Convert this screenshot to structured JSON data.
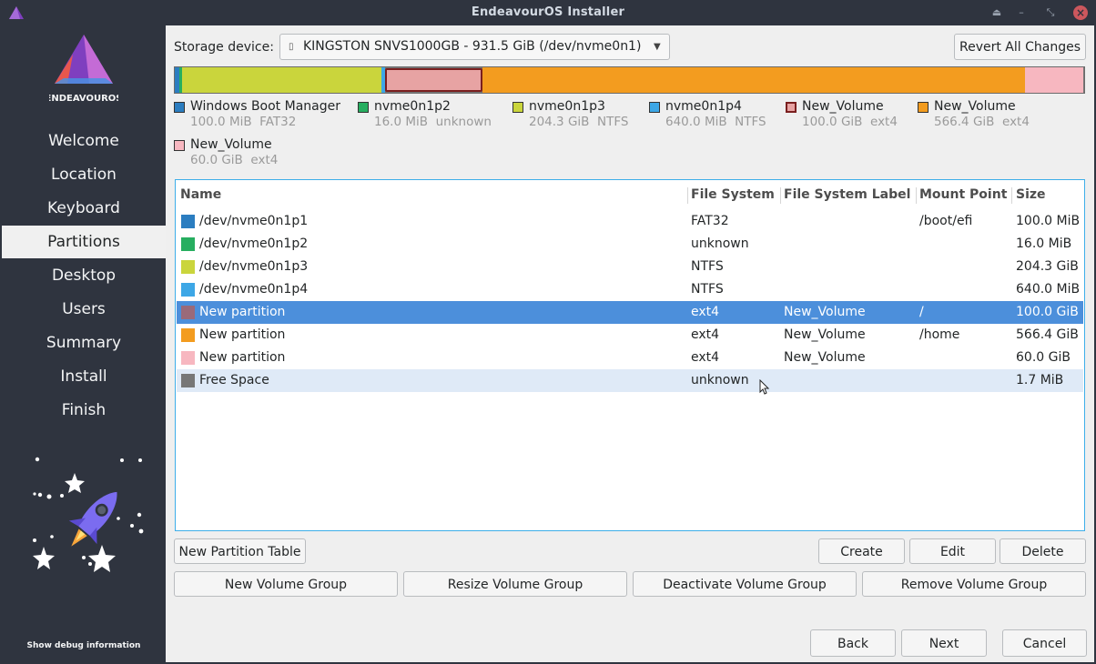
{
  "window": {
    "title": "EndeavourOS Installer"
  },
  "sidebar": {
    "logo_text": "ENDEAVOUROS",
    "items": [
      {
        "label": "Welcome",
        "active": false
      },
      {
        "label": "Location",
        "active": false
      },
      {
        "label": "Keyboard",
        "active": false
      },
      {
        "label": "Partitions",
        "active": true
      },
      {
        "label": "Desktop",
        "active": false
      },
      {
        "label": "Users",
        "active": false
      },
      {
        "label": "Summary",
        "active": false
      },
      {
        "label": "Install",
        "active": false
      },
      {
        "label": "Finish",
        "active": false
      }
    ],
    "debug_label": "Show debug information"
  },
  "storage": {
    "label": "Storage device:",
    "device": "KINGSTON SNVS1000GB - 931.5 GiB (/dev/nvme0n1)",
    "revert_label": "Revert All Changes"
  },
  "partition_bar": [
    {
      "color": "#2b7dc0",
      "fraction": 0.0001
    },
    {
      "color": "#27ae60",
      "fraction": 2e-05
    },
    {
      "color": "#cad53c",
      "fraction": 0.2193
    },
    {
      "color": "#3da7e6",
      "fraction": 0.0007
    },
    {
      "color": "#e7a3a3",
      "fraction": 0.1074,
      "outlined": true
    },
    {
      "color": "#f39c1f",
      "fraction": 0.6077
    },
    {
      "color": "#f7b7c0",
      "fraction": 0.0644
    },
    {
      "color": "#777777",
      "fraction": 0.0004
    }
  ],
  "legend": [
    {
      "name": "Windows Boot Manager",
      "info": "100.0 MiB  FAT32",
      "color": "#2b7dc0"
    },
    {
      "name": "nvme0n1p2",
      "info": "16.0 MiB  unknown",
      "color": "#27ae60"
    },
    {
      "name": "nvme0n1p3",
      "info": "204.3 GiB  NTFS",
      "color": "#cad53c"
    },
    {
      "name": "nvme0n1p4",
      "info": "640.0 MiB  NTFS",
      "color": "#3da7e6"
    },
    {
      "name": "New_Volume",
      "info": "100.0 GiB  ext4",
      "color": "#e7a3a3"
    },
    {
      "name": "New_Volume",
      "info": "566.4 GiB  ext4",
      "color": "#f39c1f"
    },
    {
      "name": "New_Volume",
      "info": "60.0 GiB  ext4",
      "color": "#f7b7c0"
    }
  ],
  "table": {
    "headers": [
      "Name",
      "File System",
      "File System Label",
      "Mount Point",
      "Size"
    ],
    "rows": [
      {
        "color": "#2b7dc0",
        "name": "/dev/nvme0n1p1",
        "fs": "FAT32",
        "label": "",
        "mount": "/boot/efi",
        "size": "100.0 MiB"
      },
      {
        "color": "#27ae60",
        "name": "/dev/nvme0n1p2",
        "fs": "unknown",
        "label": "",
        "mount": "",
        "size": "16.0 MiB"
      },
      {
        "color": "#cad53c",
        "name": "/dev/nvme0n1p3",
        "fs": "NTFS",
        "label": "",
        "mount": "",
        "size": "204.3 GiB"
      },
      {
        "color": "#3da7e6",
        "name": "/dev/nvme0n1p4",
        "fs": "NTFS",
        "label": "",
        "mount": "",
        "size": "640.0 MiB"
      },
      {
        "color": "#9a6a7a",
        "name": "New partition",
        "fs": "ext4",
        "label": "New_Volume",
        "mount": "/",
        "size": "100.0 GiB",
        "selected": true
      },
      {
        "color": "#f39c1f",
        "name": "New partition",
        "fs": "ext4",
        "label": "New_Volume",
        "mount": "/home",
        "size": "566.4 GiB"
      },
      {
        "color": "#f7b7c0",
        "name": "New partition",
        "fs": "ext4",
        "label": "New_Volume",
        "mount": "",
        "size": "60.0 GiB"
      },
      {
        "color": "#777777",
        "name": "Free Space",
        "fs": "unknown",
        "label": "",
        "mount": "",
        "size": "1.7 MiB",
        "hovered": true
      }
    ]
  },
  "actions": {
    "new_partition_table": "New Partition Table",
    "create": "Create",
    "edit": "Edit",
    "delete": "Delete",
    "new_volume_group": "New Volume Group",
    "resize_volume_group": "Resize Volume Group",
    "deactivate_volume_group": "Deactivate Volume Group",
    "remove_volume_group": "Remove Volume Group"
  },
  "footer": {
    "back": "Back",
    "next": "Next",
    "cancel": "Cancel"
  }
}
